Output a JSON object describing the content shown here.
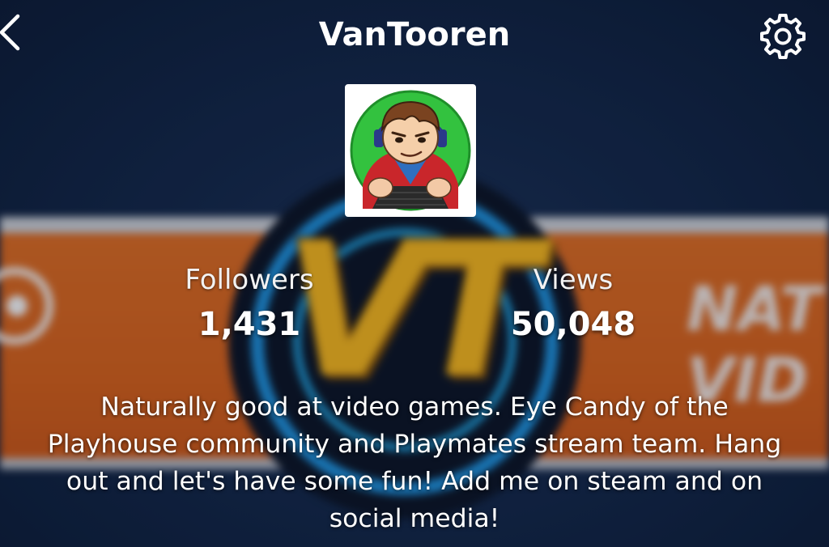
{
  "header": {
    "title": "VanTooren",
    "back_icon": "chevron-left-icon",
    "settings_icon": "gear-icon"
  },
  "banner": {
    "logo_text": "VT",
    "side_text": "NAT\nVID"
  },
  "stats": {
    "followers": {
      "label": "Followers",
      "value": "1,431"
    },
    "views": {
      "label": "Views",
      "value": "50,048"
    }
  },
  "bio": {
    "lines": [
      "Naturally good at video games. Eye Candy of the",
      "Playhouse community and Playmates stream team. Hang",
      "out and let's have some fun! Add me on steam and on",
      "social media!"
    ]
  },
  "colors": {
    "background": "#112443",
    "banner_orange": "#d35f18",
    "logo_gold": "#f1b21a",
    "ring_blue": "#1e8fd8",
    "text": "#ffffff",
    "avatar_green": "#2fbf3a"
  }
}
